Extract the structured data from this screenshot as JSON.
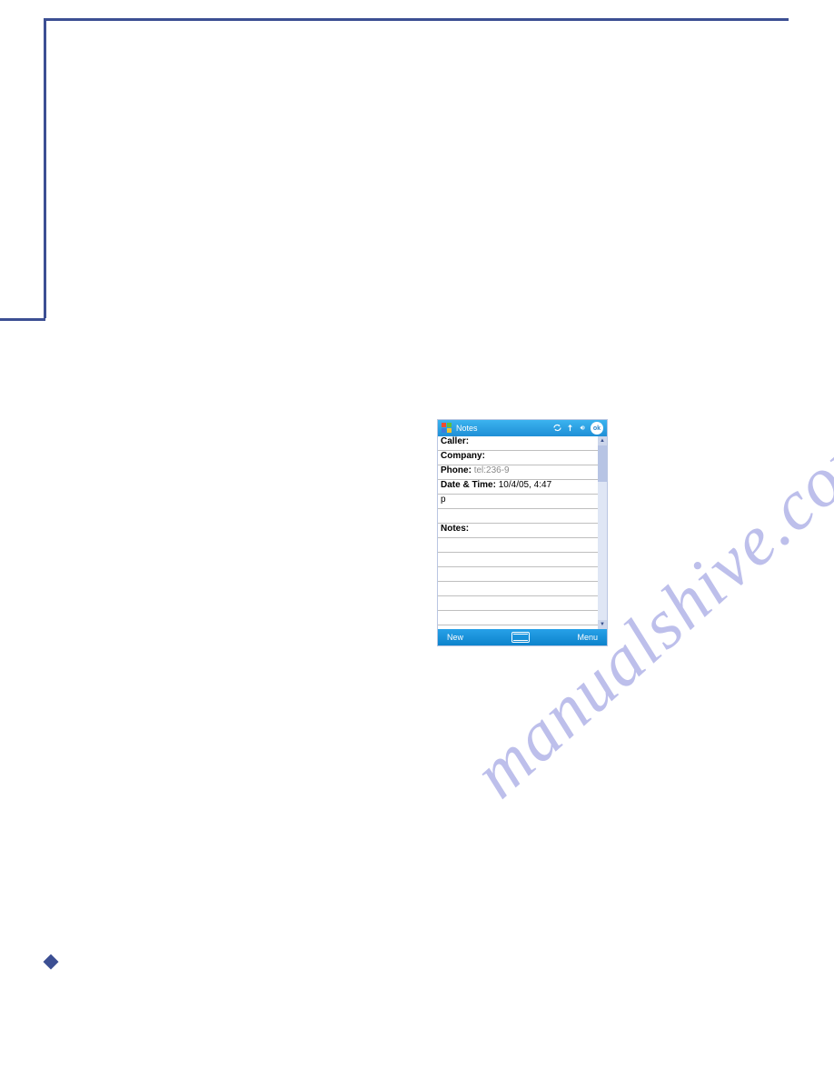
{
  "device": {
    "title": "Notes",
    "ok": "ok",
    "fields": {
      "caller_label": "Caller",
      "company_label": "Company",
      "phone_label": "Phone",
      "phone_value": "tel:236-9",
      "datetime_label": "Date & Time",
      "datetime_value": "10/4/05, 4:47",
      "datetime_second_line": "p",
      "notes_label": "Notes"
    },
    "bottombar": {
      "new": "New",
      "menu": "Menu"
    },
    "status_icons": {
      "sync": "sync-icon",
      "signal": "signal-icon",
      "speaker": "speaker-icon"
    }
  },
  "watermark": "manualshive.com"
}
